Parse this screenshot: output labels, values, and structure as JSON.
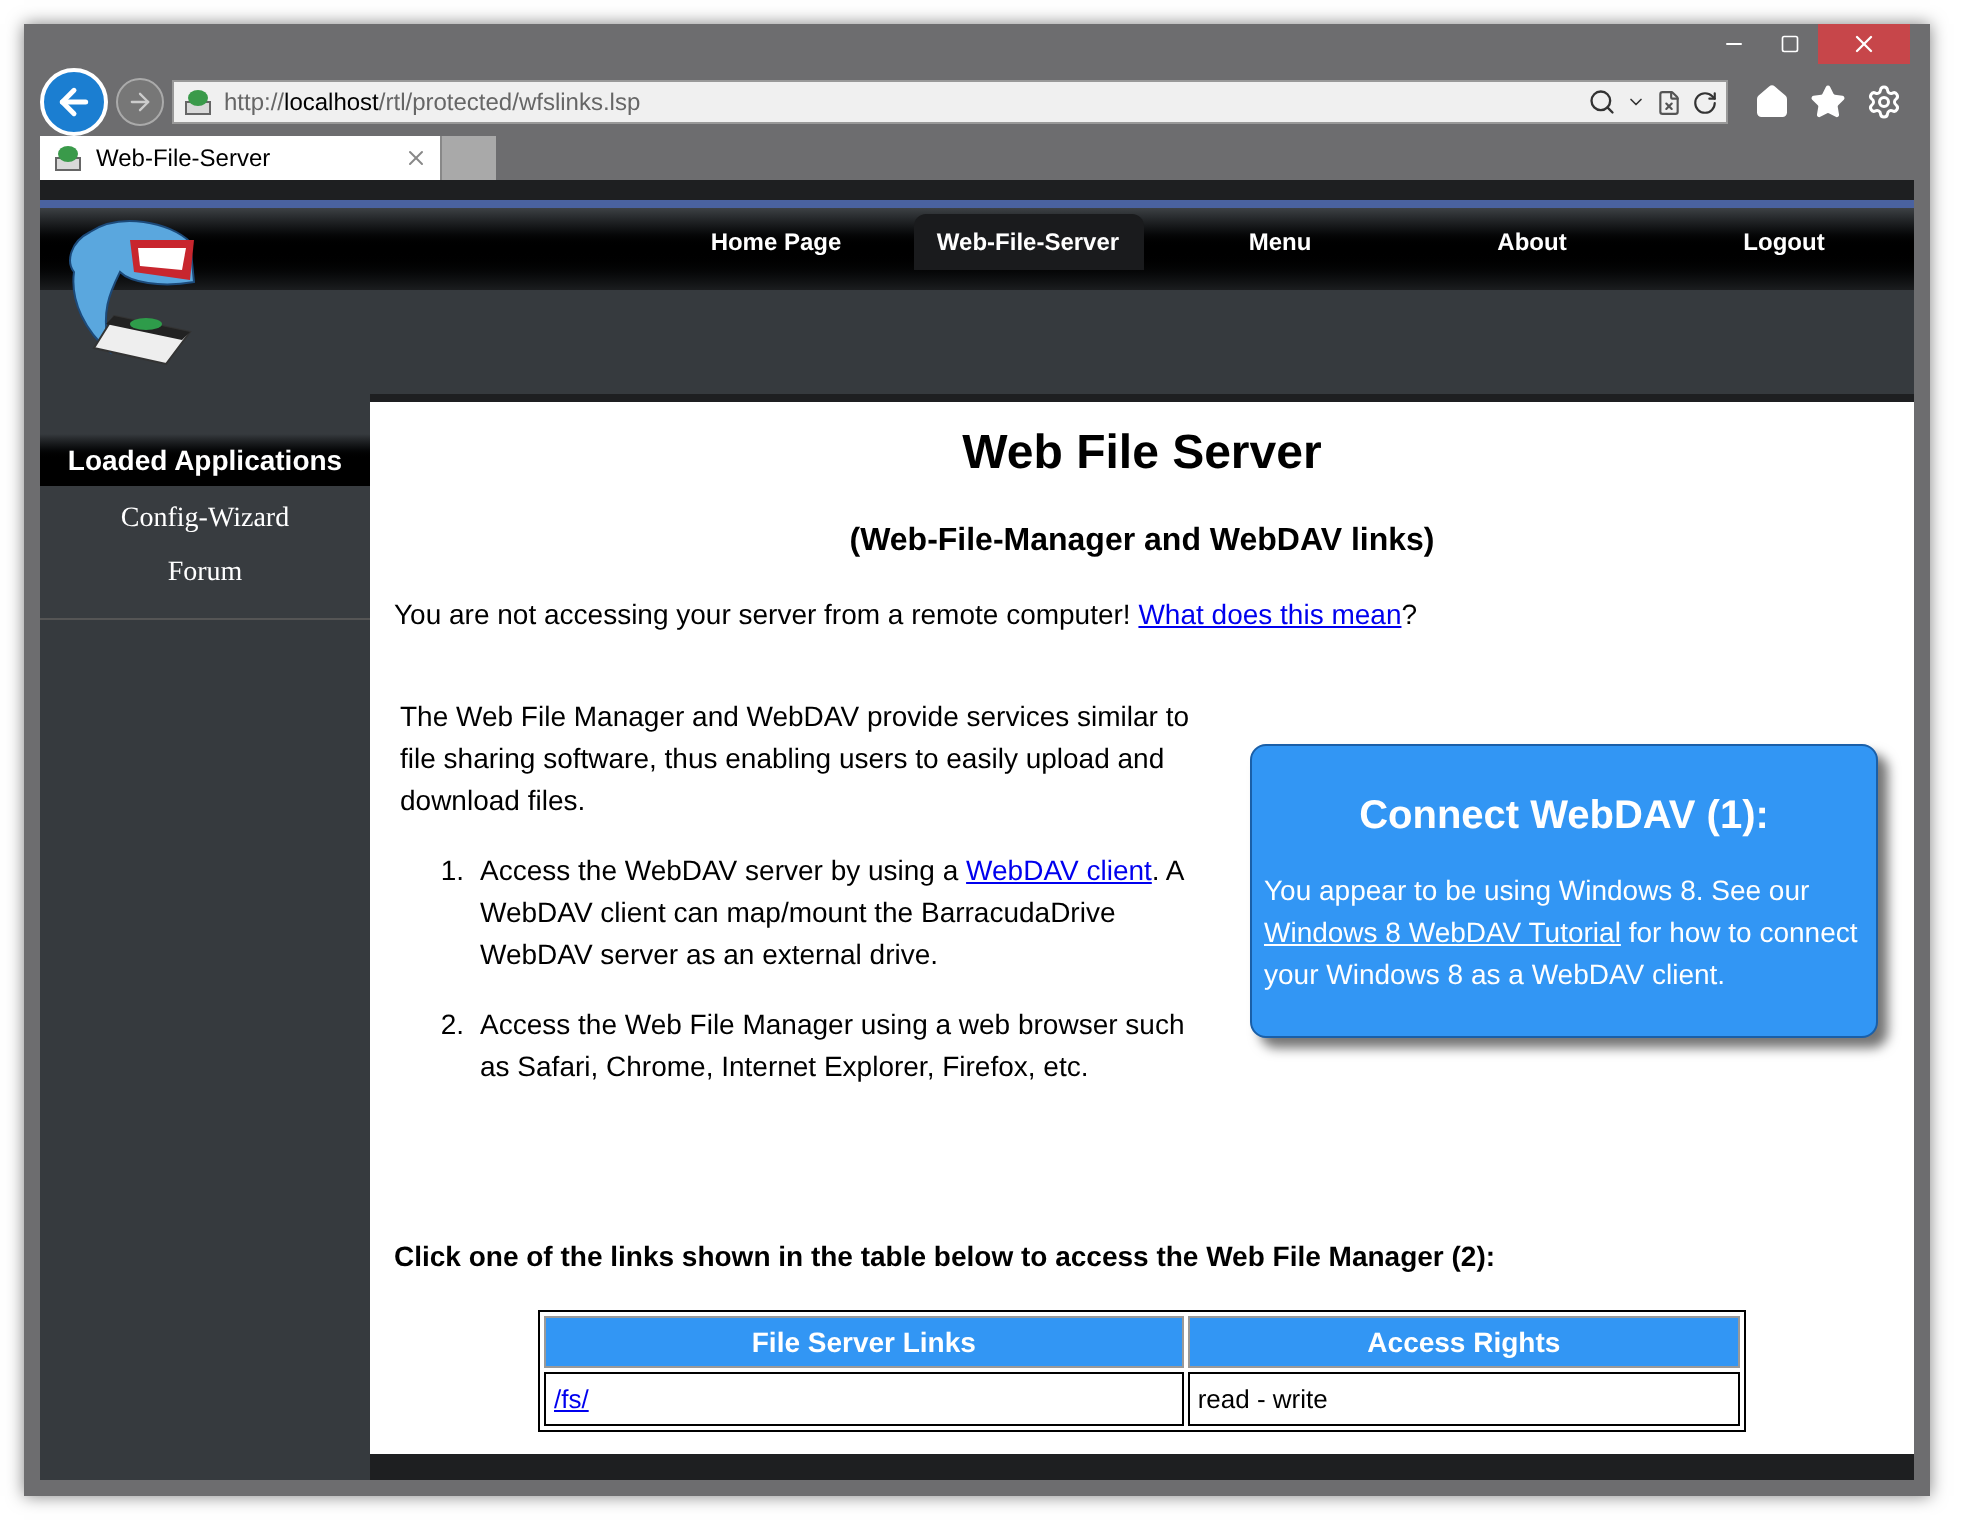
{
  "browser": {
    "url_prefix": "http://",
    "url_host": "localhost",
    "url_path": "/rtl/protected/wfslinks.lsp",
    "tabs": [
      {
        "label": "Web-File-Server",
        "selected": true
      }
    ]
  },
  "nav": [
    {
      "label": "Home Page",
      "selected": false
    },
    {
      "label": "Web-File-Server",
      "selected": true
    },
    {
      "label": "Menu",
      "selected": false
    },
    {
      "label": "About",
      "selected": false
    },
    {
      "label": "Logout",
      "selected": false
    }
  ],
  "sidebar": {
    "heading": "Loaded Applications",
    "items": [
      "Config-Wizard",
      "Forum"
    ]
  },
  "main": {
    "title": "Web File Server",
    "subtitle": "(Web-File-Manager and WebDAV links)",
    "notice": {
      "text": "You are not accessing your server from a remote computer!",
      "link": "What does this mean",
      "after": "?"
    },
    "intro": "The Web File Manager and WebDAV provide services similar to file sharing software, thus enabling users to easily upload and download files.",
    "steps": [
      {
        "number": "1.",
        "before": "Access the WebDAV server by using a",
        "link": "WebDAV client",
        "after": ". A WebDAV client can map/mount the BarracudaDrive WebDAV server as an external drive."
      },
      {
        "number": "2.",
        "before": "Access the Web File Manager using a web browser such as Safari, Chrome, Internet Explorer, Firefox, etc."
      }
    ],
    "callout": {
      "title": "Connect WebDAV (1):",
      "before": "You appear to be using Windows 8. See our",
      "link": "Windows 8 WebDAV Tutorial",
      "after": "for how to connect your Windows 8 as a WebDAV client."
    },
    "table_caption": "Click one of the links shown in the table below to access the Web File Manager (2):",
    "table": {
      "columns": [
        "File Server Links",
        "Access Rights"
      ],
      "rows": [
        [
          "/fs/",
          "read - write"
        ]
      ]
    }
  }
}
